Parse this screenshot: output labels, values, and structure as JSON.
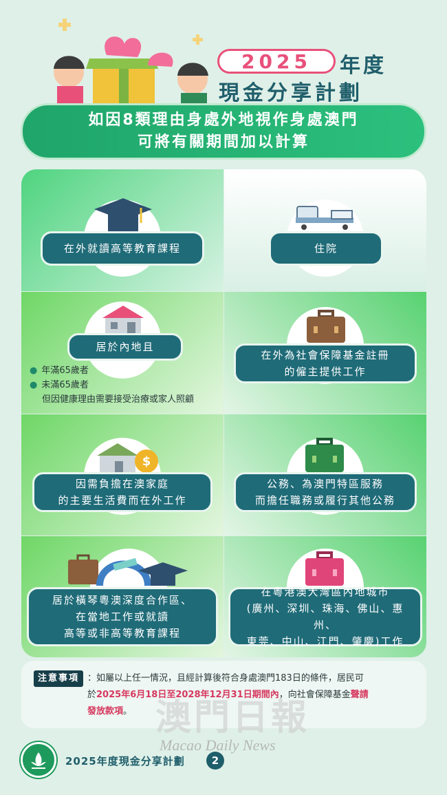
{
  "header": {
    "year": "2025",
    "year_suffix": "年度",
    "title": "現金分享計劃",
    "banner_line1": "如因8類理由身處外地視作身處澳門",
    "banner_line2": "可將有關期間加以計算"
  },
  "reasons": [
    {
      "icon": "graduation-cap-icon",
      "label": "在外就讀高等教育課程"
    },
    {
      "icon": "hospital-bed-icon",
      "label": "住院"
    },
    {
      "icon": "house-icon",
      "label": "居於內地且",
      "bullets": [
        "年滿65歲者",
        "未滿65歲者"
      ],
      "bullet_note": "但因健康理由需要接受治療或家人照顧"
    },
    {
      "icon": "brown-briefcase-icon",
      "label_line1": "在外為社會保障基金註冊",
      "label_line2": "的僱主提供工作"
    },
    {
      "icon": "house-coin-icon",
      "label_line1": "因需負擔在澳家庭",
      "label_line2": "的主要生活費而在外工作"
    },
    {
      "icon": "green-briefcase-icon",
      "label_line1": "公務、為澳門特區服務",
      "label_line2": "而擔任職務或履行其他公務"
    },
    {
      "icon": "hengqin-icons",
      "label_line1": "居於橫琴粵澳深度合作區、",
      "label_line2": "在當地工作或就讀",
      "label_line3": "高等或非高等教育課程"
    },
    {
      "icon": "pink-briefcase-icon",
      "label_line1": "在粵港澳大灣區內地城市",
      "label_line2": "(廣州、深圳、珠海、佛山、惠州、",
      "label_line3": "東莞、中山、江門、肇慶)工作"
    }
  ],
  "notice": {
    "tag": "注意事項",
    "text1": "：如屬以上任一情況，且經計算後符合身處澳門183日的條件，居民可",
    "text2a": "於",
    "date_range": "2025年6月18日至2028年12月31日期間內",
    "text2b": "，向社會保障基金",
    "action1": "聲請",
    "action2": "發放款項",
    "text3": "。"
  },
  "watermark": {
    "cn": "澳門日報",
    "en": "Macao Daily News"
  },
  "footer": {
    "title": "2025年度現金分享計劃",
    "page": "2"
  },
  "colors": {
    "teal": "#1f6b78",
    "green": "#1fa56a",
    "pink": "#e8507a",
    "red": "#d6385f"
  }
}
